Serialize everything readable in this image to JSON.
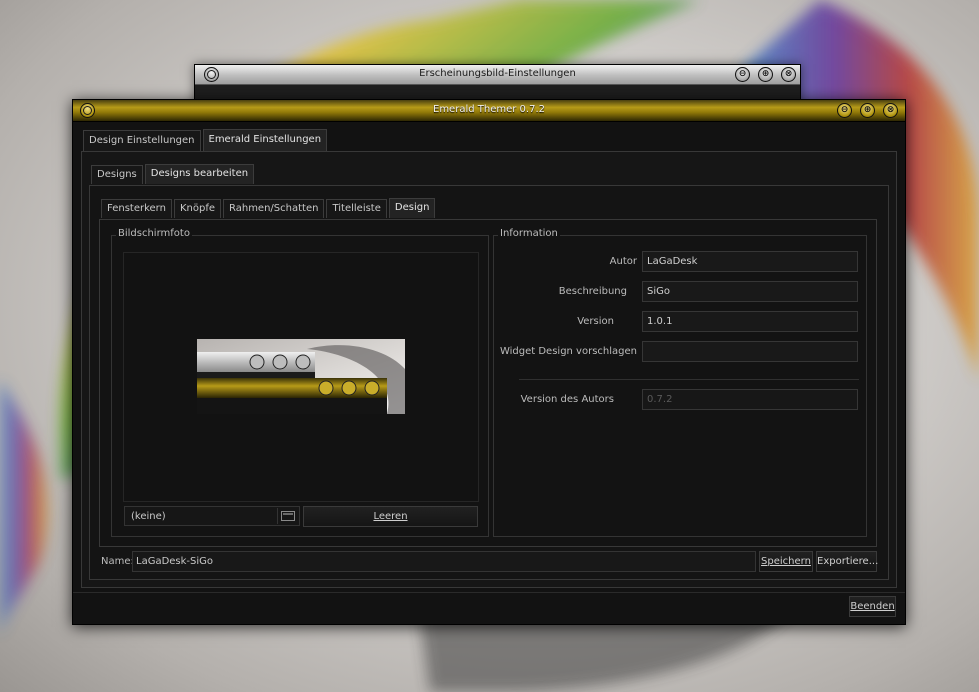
{
  "background_window": {
    "title": "Erscheinungsbild-Einstellungen",
    "buttons": {
      "minimize": "⊖",
      "maximize": "⊕",
      "close": "⊗"
    }
  },
  "main_window": {
    "title": "Emerald Themer 0.7.2",
    "buttons": {
      "minimize": "⊖",
      "maximize": "⊕",
      "close": "⊗"
    },
    "top_tabs": [
      {
        "label": "Design Einstellungen",
        "active": false
      },
      {
        "label": "Emerald Einstellungen",
        "active": true
      }
    ],
    "second_tabs": [
      {
        "label": "Designs",
        "active": false
      },
      {
        "label": "Designs bearbeiten",
        "active": true
      }
    ],
    "third_tabs": [
      {
        "label": "Fensterkern",
        "active": false
      },
      {
        "label": "Knöpfe",
        "active": false
      },
      {
        "label": "Rahmen/Schatten",
        "active": false
      },
      {
        "label": "Titelleiste",
        "active": false
      },
      {
        "label": "Design",
        "active": true
      }
    ],
    "screenshot_group": {
      "title": "Bildschirmfoto",
      "file_combo_value": "(keine)",
      "clear_button": "Leeren"
    },
    "info_group": {
      "title": "Information",
      "fields": [
        {
          "label": "Autor",
          "value": "LaGaDesk",
          "enabled": true
        },
        {
          "label": "Beschreibung",
          "value": "SiGo",
          "enabled": true
        },
        {
          "label": "Version",
          "value": "1.0.1",
          "enabled": true
        },
        {
          "label": "Widget Design vorschlagen",
          "value": "",
          "enabled": true
        }
      ],
      "author_version_label": "Version des Autors",
      "author_version_value": "0.7.2"
    },
    "name_label": "Name:",
    "name_value": "LaGaDesk-SiGo",
    "save_button": "Speichern",
    "export_button": "Exportiere...",
    "quit_button": "Beenden"
  },
  "colors": {
    "accent_gold": "#b79b18",
    "window_bg": "#121212",
    "silver_titlebar": "#bdbdbd"
  }
}
